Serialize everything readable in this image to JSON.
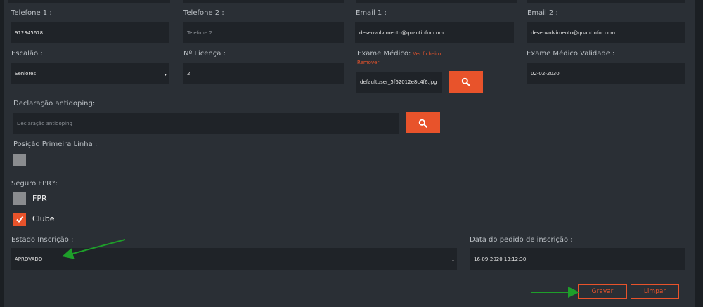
{
  "fields": {
    "telefone1": {
      "label": "Telefone 1 :",
      "value": "912345678"
    },
    "telefone2": {
      "label": "Telefone 2 :",
      "placeholder": "Telefone 2"
    },
    "email1": {
      "label": "Email 1 :",
      "value": "desenvolvimento@quantinfor.com"
    },
    "email2": {
      "label": "Email 2 :",
      "value": "desenvolvimento@quantinfor.com"
    },
    "escalao": {
      "label": "Escalão :",
      "value": "Seniores"
    },
    "licenca": {
      "label": "Nº Licença :",
      "value": "2"
    },
    "exame": {
      "label": "Exame Médico:",
      "link_ver": "Ver ficheiro",
      "link_remover": "Remover",
      "value": "defaultuser_5f62012e8c4f6.jpg"
    },
    "exame_validade": {
      "label": "Exame Médico Validade :",
      "value": "02-02-2030"
    },
    "antidoping": {
      "label": "Declaração antidoping:",
      "placeholder": "Declaração antidoping"
    },
    "posicao": {
      "label": "Posição Primeira Linha :"
    },
    "seguro": {
      "label": "Seguro FPR?:",
      "opt1": "FPR",
      "opt2": "Clube"
    },
    "estado": {
      "label": "Estado Inscrição :",
      "value": "APROVADO"
    },
    "data_pedido": {
      "label": "Data do pedido de inscrição :",
      "value": "16-09-2020 13:12:30"
    }
  },
  "buttons": {
    "gravar": "Gravar",
    "limpar": "Limpar"
  },
  "icons": {
    "search": "search-icon",
    "check": "check-icon",
    "select_arrow": "caret-icon"
  },
  "colors": {
    "accent": "#e8532b",
    "background": "#2a2f35",
    "field": "#1f2328",
    "annotation_arrow": "#1e9e2a"
  }
}
